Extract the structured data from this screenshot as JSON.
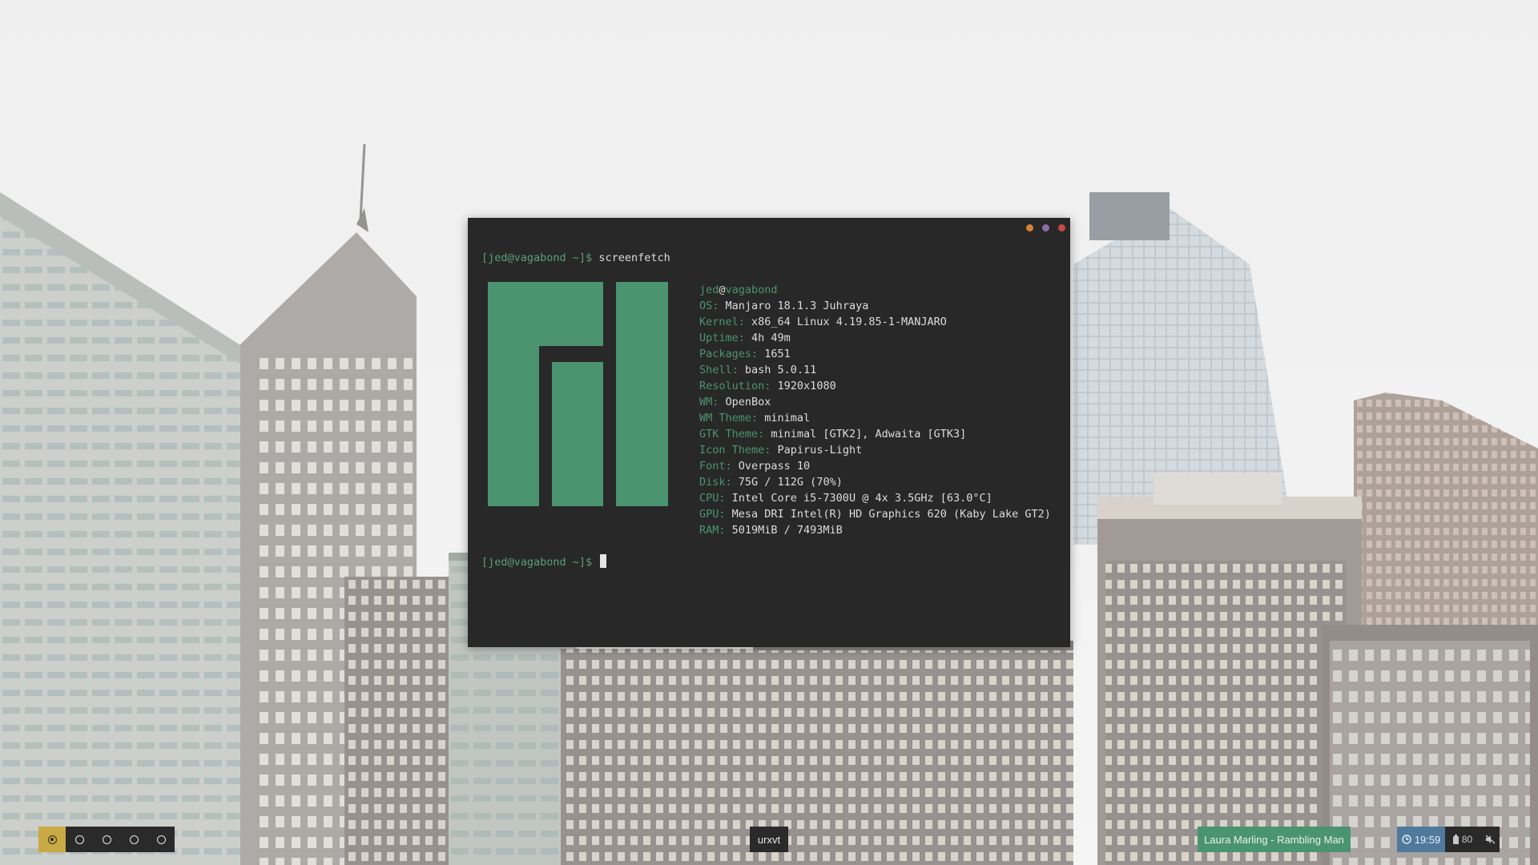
{
  "terminal": {
    "window_title": "urxvt",
    "prompt": "[jed@vagabond ~]$",
    "command": "screenfetch",
    "user": "jed",
    "at": "@",
    "host": "vagabond",
    "info": [
      {
        "key": "OS: ",
        "value": "Manjaro 18.1.3 Juhraya"
      },
      {
        "key": "Kernel: ",
        "value": "x86_64 Linux 4.19.85-1-MANJARO"
      },
      {
        "key": "Uptime: ",
        "value": "4h 49m"
      },
      {
        "key": "Packages: ",
        "value": "1651"
      },
      {
        "key": "Shell: ",
        "value": "bash 5.0.11"
      },
      {
        "key": "Resolution: ",
        "value": "1920x1080"
      },
      {
        "key": "WM: ",
        "value": "OpenBox"
      },
      {
        "key": "WM Theme: ",
        "value": "minimal"
      },
      {
        "key": "GTK Theme: ",
        "value": "minimal [GTK2], Adwaita [GTK3]"
      },
      {
        "key": "Icon Theme: ",
        "value": "Papirus-Light"
      },
      {
        "key": "Font: ",
        "value": "Overpass 10"
      },
      {
        "key": "Disk: ",
        "value": "75G / 112G (70%)"
      },
      {
        "key": "CPU: ",
        "value": "Intel Core i5-7300U @ 4x 3.5GHz [63.0°C]"
      },
      {
        "key": "GPU: ",
        "value": "Mesa DRI Intel(R) HD Graphics 620 (Kaby Lake GT2)"
      },
      {
        "key": "RAM: ",
        "value": "5019MiB / 7493MiB"
      }
    ],
    "buttons": {
      "minimize_color": "#d7813a",
      "maximize_color": "#8a6fa3",
      "close_color": "#c44848"
    },
    "accent": "#4b9470"
  },
  "panel": {
    "workspaces": {
      "count": 5,
      "active": 1
    },
    "taskbar_label": "urxvt",
    "now_playing": "Laura Marling - Rambling Man",
    "clock": "19:59",
    "battery": "80",
    "volume_icon": "volume-muted-icon",
    "colors": {
      "workspace_active": "#c9a944",
      "now_playing": "#4b9470",
      "clock": "#4f7a9c"
    }
  }
}
